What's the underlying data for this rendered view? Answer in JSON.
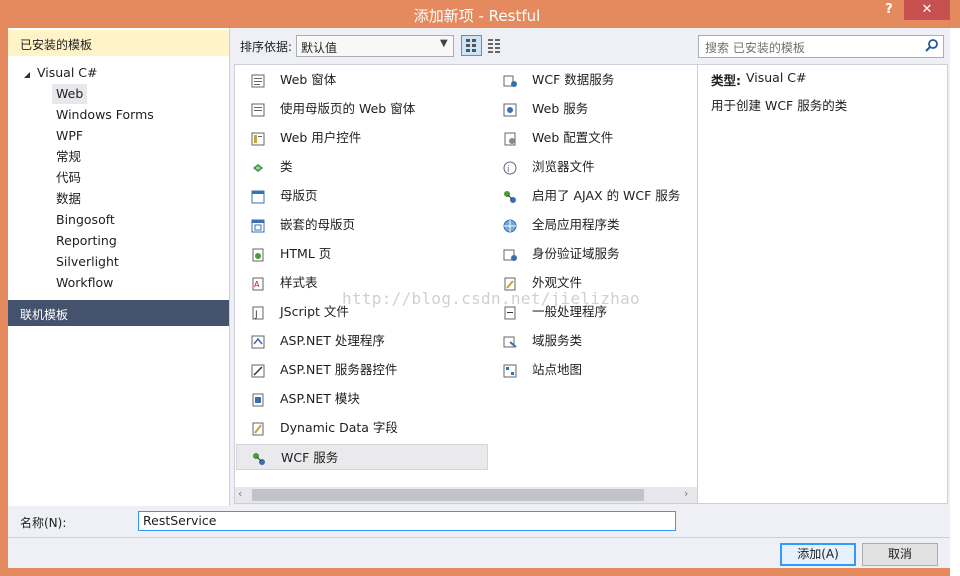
{
  "window": {
    "title": "添加新项 - Restful",
    "help_label": "?",
    "close_label": "✕"
  },
  "left_panel": {
    "installed_header": "已安装的模板",
    "tree_root": "Visual C#",
    "tree_items": [
      "Web",
      "Windows Forms",
      "WPF",
      "常规",
      "代码",
      "数据",
      "Bingosoft",
      "Reporting",
      "Silverlight",
      "Workflow"
    ],
    "selected_item": "Web",
    "online_header": "联机模板"
  },
  "toolbar": {
    "sort_label": "排序依据:",
    "sort_value": "默认值"
  },
  "search": {
    "placeholder": "搜索 已安装的模板"
  },
  "templates": {
    "column1": [
      {
        "label": "Web 窗体",
        "icon": "web-form-icon"
      },
      {
        "label": "使用母版页的 Web 窗体",
        "icon": "web-form-master-icon"
      },
      {
        "label": "Web 用户控件",
        "icon": "user-control-icon"
      },
      {
        "label": "类",
        "icon": "class-icon"
      },
      {
        "label": "母版页",
        "icon": "master-page-icon"
      },
      {
        "label": "嵌套的母版页",
        "icon": "nested-master-page-icon"
      },
      {
        "label": "HTML 页",
        "icon": "html-page-icon"
      },
      {
        "label": "样式表",
        "icon": "stylesheet-icon"
      },
      {
        "label": "JScript 文件",
        "icon": "jscript-file-icon"
      },
      {
        "label": "ASP.NET 处理程序",
        "icon": "handler-icon"
      },
      {
        "label": "ASP.NET 服务器控件",
        "icon": "server-control-icon"
      },
      {
        "label": "ASP.NET 模块",
        "icon": "module-icon"
      },
      {
        "label": "Dynamic Data 字段",
        "icon": "dynamic-data-icon"
      },
      {
        "label": "WCF 服务",
        "icon": "wcf-service-icon"
      }
    ],
    "column2": [
      {
        "label": "WCF 数据服务",
        "icon": "wcf-data-service-icon"
      },
      {
        "label": "Web 服务",
        "icon": "web-service-icon"
      },
      {
        "label": "Web 配置文件",
        "icon": "web-config-icon"
      },
      {
        "label": "浏览器文件",
        "icon": "browser-file-icon"
      },
      {
        "label": "启用了 AJAX 的 WCF 服务",
        "icon": "ajax-wcf-icon"
      },
      {
        "label": "全局应用程序类",
        "icon": "global-app-class-icon"
      },
      {
        "label": "身份验证域服务",
        "icon": "auth-domain-service-icon"
      },
      {
        "label": "外观文件",
        "icon": "skin-file-icon"
      },
      {
        "label": "一般处理程序",
        "icon": "generic-handler-icon"
      },
      {
        "label": "域服务类",
        "icon": "domain-service-class-icon"
      },
      {
        "label": "站点地图",
        "icon": "sitemap-icon"
      }
    ],
    "selected": "WCF 服务"
  },
  "description": {
    "type_label": "类型:",
    "type_value": "Visual C#",
    "text": "用于创建 WCF 服务的类"
  },
  "footer": {
    "name_label": "名称(N):",
    "name_value": "RestService",
    "add_button": "添加(A)",
    "cancel_button": "取消"
  },
  "watermark": "http://blog.csdn.net/jielizhao",
  "colors": {
    "title_bar": "#e58a5e",
    "close_button": "#c75050",
    "installed_header_bg": "#fff4c8",
    "online_header_bg": "#44526e",
    "selection_border": "#3399ff"
  }
}
